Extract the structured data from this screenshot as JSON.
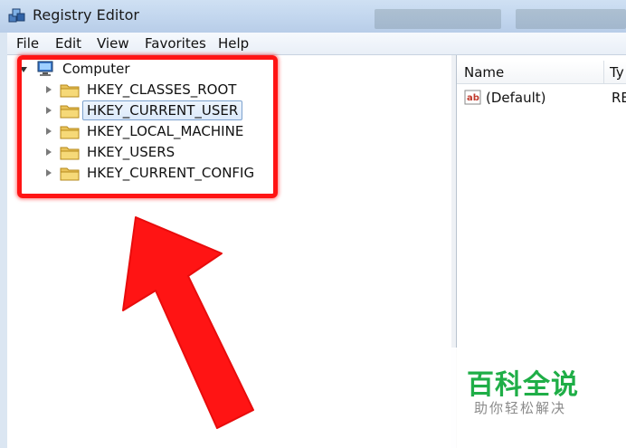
{
  "window": {
    "title": "Registry Editor",
    "icon": "registry-editor-icon"
  },
  "menu": [
    "File",
    "Edit",
    "View",
    "Favorites",
    "Help"
  ],
  "tree": {
    "root": {
      "label": "Computer",
      "icon": "computer-icon"
    },
    "hives": [
      {
        "label": "HKEY_CLASSES_ROOT",
        "selected": false
      },
      {
        "label": "HKEY_CURRENT_USER",
        "selected": true
      },
      {
        "label": "HKEY_LOCAL_MACHINE",
        "selected": false
      },
      {
        "label": "HKEY_USERS",
        "selected": false
      },
      {
        "label": "HKEY_CURRENT_CONFIG",
        "selected": false
      }
    ]
  },
  "values_pane": {
    "columns": [
      "Name",
      "Ty"
    ],
    "rows": [
      {
        "name": "(Default)",
        "type": "RE",
        "icon": "string-value-icon"
      }
    ]
  },
  "annotation": {
    "highlight_color": "#ff1414",
    "arrow_color": "#ff1414"
  },
  "watermark": {
    "title": "百科全说",
    "subtitle": "助你轻松解决",
    "color": "#1fae47"
  }
}
